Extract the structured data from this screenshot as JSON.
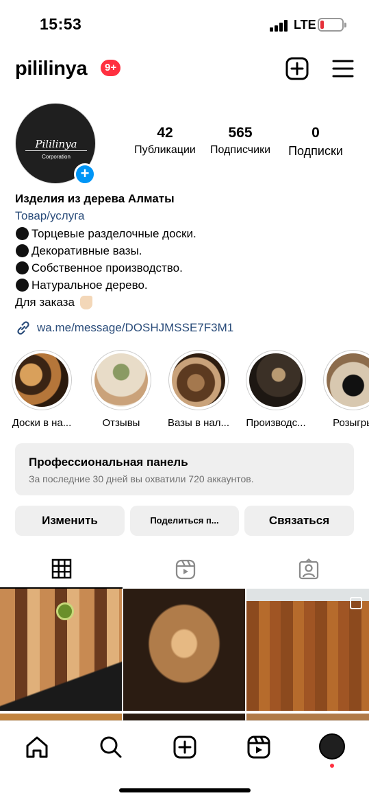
{
  "status_bar": {
    "time": "15:53",
    "network": "LTE",
    "battery_level": 0.15,
    "battery_color": "#e5303a"
  },
  "header": {
    "username": "pililinya",
    "notification_badge": "9+",
    "badge_color": "#ff3040"
  },
  "profile": {
    "avatar_logo_text": "Pililinya",
    "avatar_sub_text": "Corporation",
    "stats": [
      {
        "value": "42",
        "label": "Публикации"
      },
      {
        "value": "565",
        "label": "Подписчики"
      },
      {
        "value": "0",
        "label": "Подписки"
      }
    ]
  },
  "bio": {
    "name": "Изделия из дерева Алматы",
    "category": "Товар/услуга",
    "lines": [
      "Торцевые разделочные доски.",
      "Декоративные вазы.",
      "Собственное производство.",
      "Натуральное дерево."
    ],
    "order_line": "Для заказа",
    "link": "wa.me/message/DOSHJMSSE7F3M1",
    "link_color": "#2a4c7a"
  },
  "highlights": [
    {
      "label": "Доски в на...",
      "icon": "cutting-board-photo"
    },
    {
      "label": "Отзывы",
      "icon": "plant-vase-photo"
    },
    {
      "label": "Вазы в нал...",
      "icon": "vases-photo"
    },
    {
      "label": "Производс...",
      "icon": "dried-flowers-photo"
    },
    {
      "label": "Розыгры",
      "icon": "vase-photo"
    }
  ],
  "dashboard": {
    "title": "Профессиональная панель",
    "subtitle": "За последние 30 дней вы охватили 720 аккаунтов."
  },
  "actions": {
    "edit": "Изменить",
    "share": "Поделиться п...",
    "contact": "Связаться"
  },
  "tabs": [
    {
      "icon": "grid-icon",
      "active": true
    },
    {
      "icon": "reels-icon",
      "active": false
    },
    {
      "icon": "tagged-icon",
      "active": false
    }
  ],
  "posts": [
    {
      "icon": "cutting-board-kiwi-photo"
    },
    {
      "icon": "wooden-bowl-photo"
    },
    {
      "icon": "end-grain-board-photo",
      "multi": true
    }
  ],
  "bottom_nav": [
    {
      "icon": "home-icon"
    },
    {
      "icon": "search-icon"
    },
    {
      "icon": "create-icon"
    },
    {
      "icon": "reels-icon"
    },
    {
      "icon": "profile-avatar"
    }
  ]
}
